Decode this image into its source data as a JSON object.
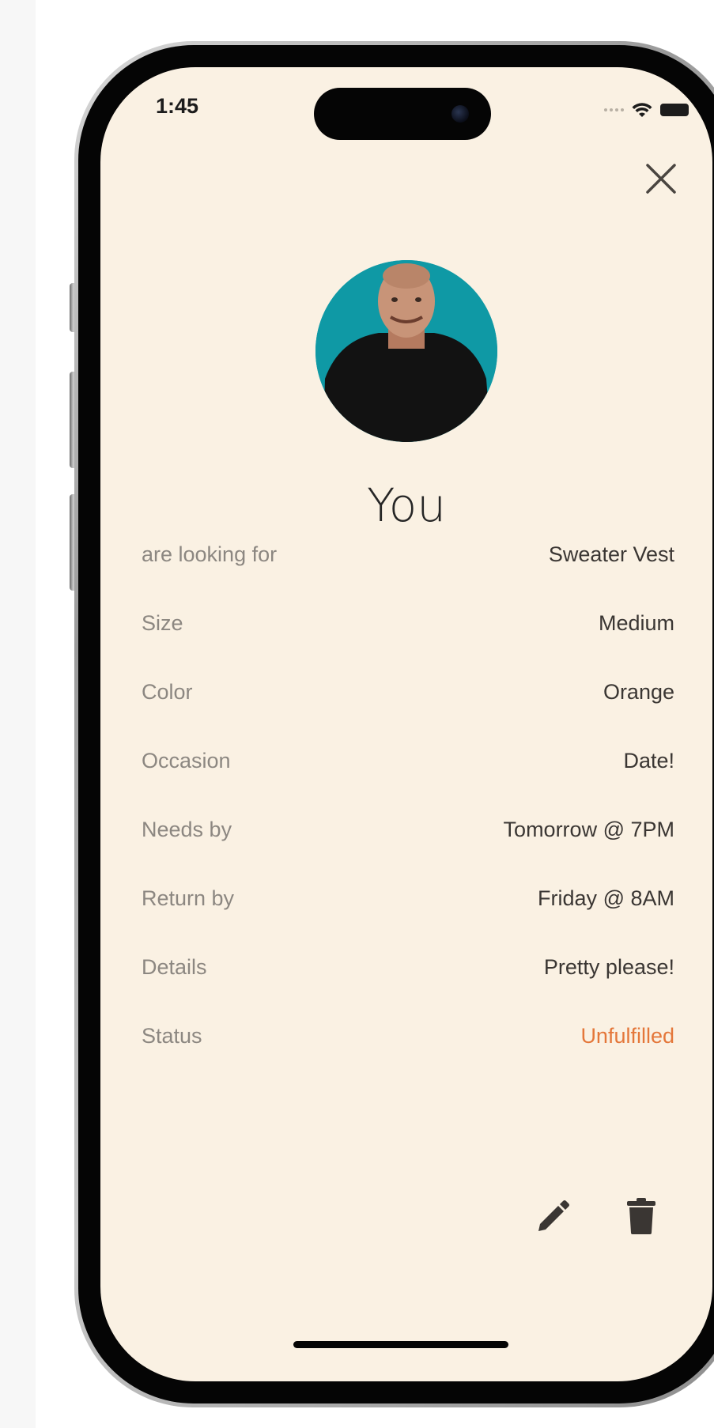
{
  "status_bar": {
    "time": "1:45"
  },
  "profile": {
    "name": "You",
    "avatar_colors": {
      "background": "#0f99a5",
      "shirt": "#111111",
      "skin": "#c89478"
    }
  },
  "details": [
    {
      "label": "are looking for",
      "value": "Sweater Vest"
    },
    {
      "label": "Size",
      "value": "Medium"
    },
    {
      "label": "Color",
      "value": "Orange"
    },
    {
      "label": "Occasion",
      "value": "Date!"
    },
    {
      "label": "Needs by",
      "value": "Tomorrow @ 7PM"
    },
    {
      "label": "Return by",
      "value": "Friday @ 8AM"
    },
    {
      "label": "Details",
      "value": "Pretty please!"
    },
    {
      "label": "Status",
      "value": "Unfulfilled"
    }
  ],
  "actions": {
    "close_icon": "close-icon",
    "edit_icon": "pencil-icon",
    "delete_icon": "trash-icon"
  },
  "colors": {
    "screen_background": "#faf1e3",
    "status_accent": "#e4773a",
    "label_text": "#8c8781",
    "value_text": "#3a3633"
  }
}
